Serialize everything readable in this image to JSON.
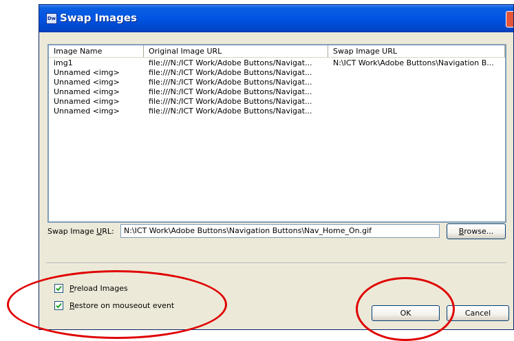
{
  "window": {
    "title": "Swap Images",
    "icon": "dreamweaver-icon"
  },
  "list": {
    "columns": [
      "Image Name",
      "Original Image URL",
      "Swap Image URL"
    ],
    "rows": [
      {
        "name": "img1",
        "original": "file:///N:/ICT Work/Adobe Buttons/Navigat...",
        "swap": "N:\\ICT Work\\Adobe Buttons\\Navigation B..."
      },
      {
        "name": "Unnamed <img>",
        "original": "file:///N:/ICT Work/Adobe Buttons/Navigat...",
        "swap": ""
      },
      {
        "name": "Unnamed <img>",
        "original": "file:///N:/ICT Work/Adobe Buttons/Navigat...",
        "swap": ""
      },
      {
        "name": "Unnamed <img>",
        "original": "file:///N:/ICT Work/Adobe Buttons/Navigat...",
        "swap": ""
      },
      {
        "name": "Unnamed <img>",
        "original": "file:///N:/ICT Work/Adobe Buttons/Navigat...",
        "swap": ""
      },
      {
        "name": "Unnamed <img>",
        "original": "file:///N:/ICT Work/Adobe Buttons/Navigat...",
        "swap": ""
      }
    ]
  },
  "swap_field": {
    "label_prefix": "Swap Image ",
    "label_underlined": "U",
    "label_suffix": "RL:",
    "value": "N:\\ICT Work\\Adobe Buttons\\Navigation Buttons\\Nav_Home_On.gif"
  },
  "buttons": {
    "browse_underlined": "B",
    "browse_rest": "rowse...",
    "ok": "OK",
    "cancel": "Cancel"
  },
  "options": {
    "preload_underlined": "P",
    "preload_rest": "reload Images",
    "preload_checked": true,
    "restore_underlined": "R",
    "restore_rest": "estore on mouseout event",
    "restore_checked": true
  },
  "colors": {
    "title_bar": "#0054e3",
    "annotation": "#e00000",
    "dialog_bg": "#ece9d8"
  }
}
